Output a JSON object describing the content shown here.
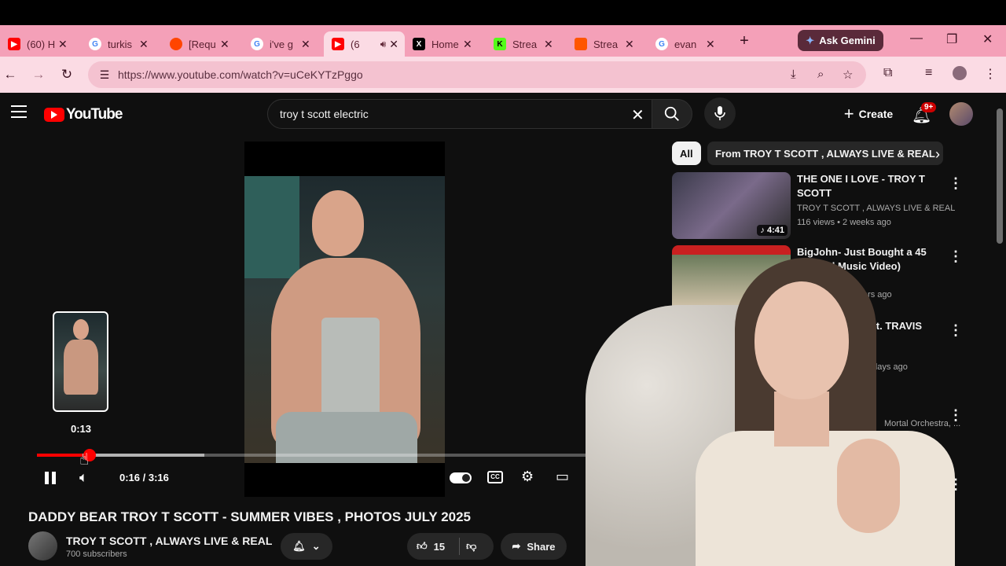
{
  "browser": {
    "tabs": [
      {
        "title": "(60) H",
        "icon": "youtube-icon",
        "color": "#ff0000",
        "active": false
      },
      {
        "title": "turkis",
        "icon": "google-icon",
        "color": "#4285f4",
        "active": false
      },
      {
        "title": "[Requ",
        "icon": "reddit-icon",
        "color": "#ff4500",
        "active": false
      },
      {
        "title": "i've g",
        "icon": "google-icon",
        "color": "#4285f4",
        "active": false
      },
      {
        "title": "(6",
        "icon": "youtube-icon",
        "color": "#ff0000",
        "active": true,
        "audio": true
      },
      {
        "title": "Home",
        "icon": "x-icon",
        "color": "#000000",
        "active": false
      },
      {
        "title": "Strea",
        "icon": "kick-icon",
        "color": "#53fc18",
        "active": false
      },
      {
        "title": "Strea",
        "icon": "soundcloud-icon",
        "color": "#ff5500",
        "active": false
      },
      {
        "title": "evan",
        "icon": "google-icon",
        "color": "#4285f4",
        "active": false
      }
    ],
    "gemini_label": "Ask Gemini",
    "url": "https://www.youtube.com/watch?v=uCeKYTzPggo"
  },
  "youtube": {
    "logo_text": "YouTube",
    "search_value": "troy t scott electric",
    "create_label": "Create",
    "notif_badge": "9+"
  },
  "player": {
    "preview_time": "0:13",
    "time_display": "0:16 / 3:16",
    "progress_fraction": 0.082
  },
  "video": {
    "title": "DADDY BEAR TROY T SCOTT - SUMMER VIBES , PHOTOS JULY 2025",
    "channel": "TROY T SCOTT  , ALWAYS LIVE & REAL",
    "subscribers": "700 subscribers",
    "likes": "15",
    "share_label": "Share"
  },
  "sidebar": {
    "chips": [
      "All",
      "From TROY T SCOTT , ALWAYS LIVE & REAL"
    ],
    "recs": [
      {
        "title": "THE ONE I LOVE - TROY T SCOTT",
        "channel": "TROY T SCOTT , ALWAYS LIVE & REAL",
        "meta": "116 views • 2 weeks ago",
        "duration": "4:41"
      },
      {
        "title": "BigJohn- Just Bought a 45 (Official Music Video)",
        "channel": "",
        "meta": "15 years ago",
        "duration": ""
      },
      {
        "title": "ER (feat. TRAVIS",
        "channel": "",
        "meta": "5 days ago",
        "duration": ""
      },
      {
        "title": "",
        "channel": "Mortal Orchestra, ...",
        "meta": "",
        "duration": ""
      }
    ]
  }
}
